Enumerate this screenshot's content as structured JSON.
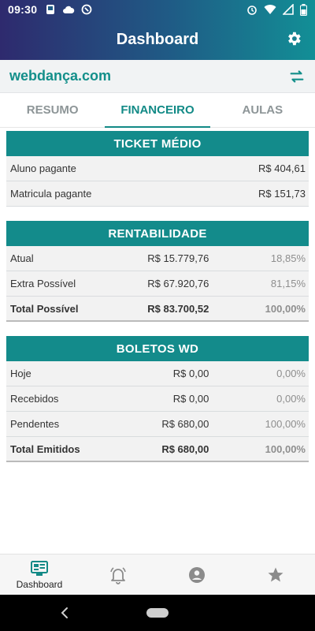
{
  "status_bar": {
    "time": "09:30",
    "icons_left": [
      "notification-icon",
      "cloud-icon",
      "sync-icon"
    ],
    "icons_right": [
      "alarm-icon",
      "wifi-icon",
      "signal-icon",
      "battery-icon"
    ]
  },
  "app": {
    "title": "Dashboard"
  },
  "site": {
    "name": "webdança.com"
  },
  "tabs": [
    {
      "label": "RESUMO",
      "active": false
    },
    {
      "label": "FINANCEIRO",
      "active": true
    },
    {
      "label": "AULAS",
      "active": false
    }
  ],
  "ticket_medio": {
    "title": "TICKET MÉDIO",
    "rows": [
      {
        "label": "Aluno pagante",
        "value": "R$ 404,61"
      },
      {
        "label": "Matricula pagante",
        "value": "R$ 151,73"
      }
    ]
  },
  "rentabilidade": {
    "title": "RENTABILIDADE",
    "rows": [
      {
        "label": "Atual",
        "value": "R$ 15.779,76",
        "percent": "18,85%"
      },
      {
        "label": "Extra Possível",
        "value": "R$ 67.920,76",
        "percent": "81,15%"
      }
    ],
    "total": {
      "label": "Total Possível",
      "value": "R$ 83.700,52",
      "percent": "100,00%"
    }
  },
  "boletos": {
    "title": "BOLETOS WD",
    "rows": [
      {
        "label": "Hoje",
        "value": "R$ 0,00",
        "percent": "0,00%"
      },
      {
        "label": "Recebidos",
        "value": "R$ 0,00",
        "percent": "0,00%"
      },
      {
        "label": "Pendentes",
        "value": "R$ 680,00",
        "percent": "100,00%"
      }
    ],
    "total": {
      "label": "Total Emitidos",
      "value": "R$ 680,00",
      "percent": "100,00%"
    }
  },
  "bottom_nav": {
    "items": [
      {
        "label": "Dashboard",
        "icon": "dashboard-icon",
        "active": true
      },
      {
        "label": "",
        "icon": "bell-icon"
      },
      {
        "label": "",
        "icon": "account-icon"
      },
      {
        "label": "",
        "icon": "star-icon"
      }
    ]
  },
  "colors": {
    "accent": "#128a86",
    "header_start": "#2e2a6e",
    "header_end": "#128f96",
    "section_header": "#138b8b"
  }
}
